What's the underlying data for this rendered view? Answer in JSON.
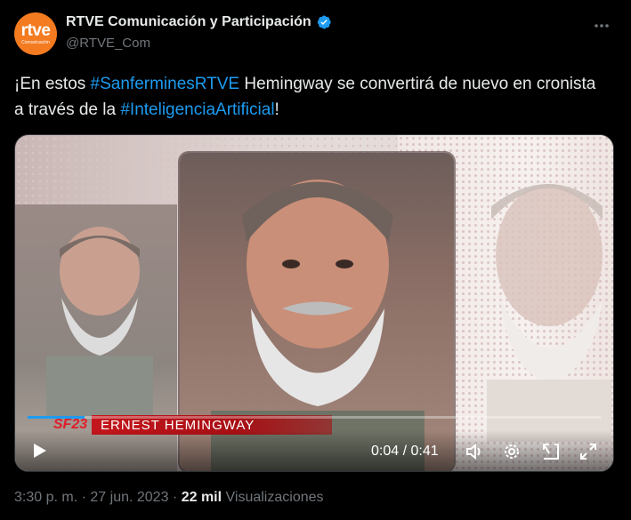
{
  "account": {
    "display_name": "RTVE Comunicación y Participación",
    "handle": "@RTVE_Com",
    "avatar_logo": "rtve",
    "avatar_sub": "Comunicación",
    "verified": true
  },
  "tweet": {
    "text_1": "¡En estos ",
    "hashtag_1": "#SanferminesRTVE",
    "text_2": " Hemingway se convertirá de nuevo en cronista a través de la ",
    "hashtag_2": "#InteligenciaArtificial",
    "text_3": "!"
  },
  "media": {
    "caption_name": "Ernest Hemingway",
    "logo_text": "SF23",
    "time": "0:04 / 0:41",
    "progress": 0.1
  },
  "footer": {
    "time": "3:30 p. m.",
    "sep1": "·",
    "date": "27 jun. 2023",
    "sep2": "·",
    "views_count": "22 mil",
    "views_label": "Visualizaciones"
  },
  "colors": {
    "accent": "#1d9bf0",
    "brand": "#f47b20",
    "lower_third": "#c4161c"
  },
  "icons": [
    "verified-badge-icon",
    "more-icon",
    "play-icon",
    "volume-icon",
    "settings-icon",
    "pip-icon",
    "fullscreen-icon"
  ]
}
